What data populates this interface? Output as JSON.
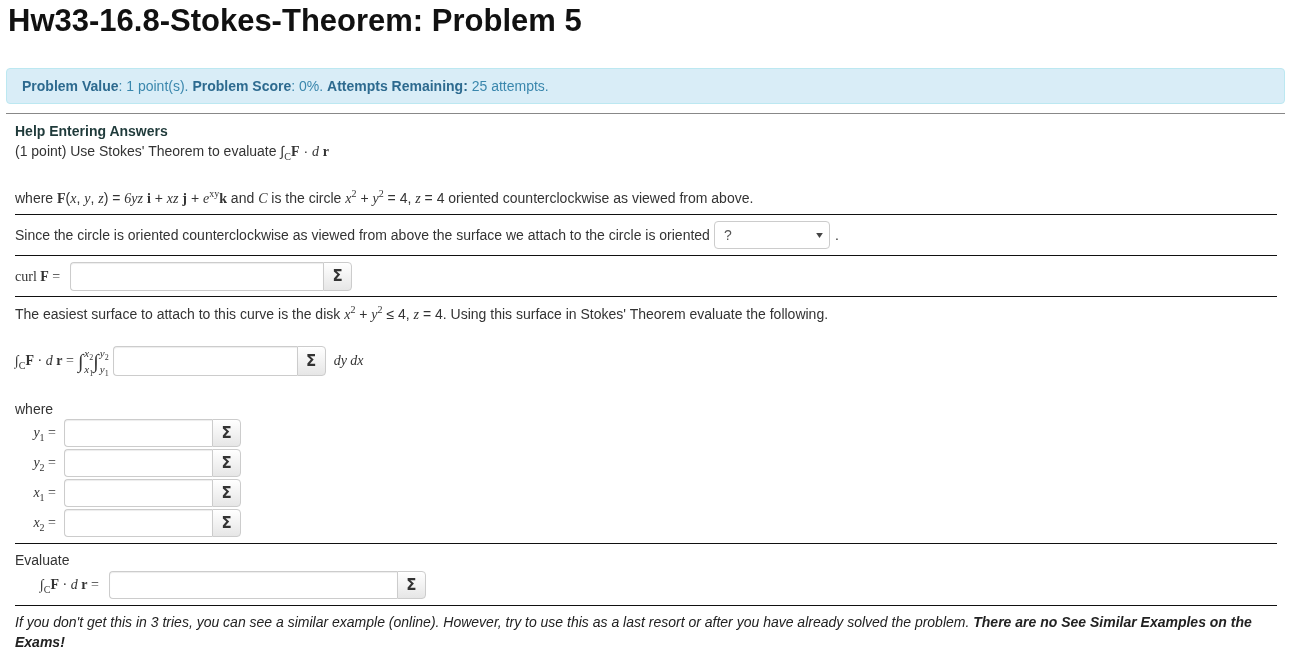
{
  "page_title": "Hw33-16.8-Stokes-Theorem: Problem 5",
  "info_bar": {
    "text": "**Problem Value**: 1 point(s). **Problem Score**: 0%. **Attempts Remaining:** 25 attempts."
  },
  "help_link": "Help Entering Answers",
  "problem": {
    "intro": "(1 point) Use Stokes' Theorem to evaluate ∫$_{C}$**F** · *d* **r**",
    "statement": "where **F**(*x*, *y*, *z*) = *6yz* **i** + *xz* **j** + *e*$^{xy}$**k** and *C* is the circle *x*$^{2}$ + *y*$^{2}$ = 4, *z* = 4 oriented counterclockwise as viewed from above.",
    "orientation": {
      "text": "Since the circle is oriented counterclockwise as viewed from above the surface we attach to the circle is oriented",
      "dropdown": {
        "value": "?"
      },
      "text_after": "."
    },
    "curl": {
      "label": "curl **F** =",
      "button": "Σ"
    },
    "surface_text": "The easiest surface to attach to this curve is the disk *x*$^{2}$ + *y*$^{2}$ ≤ 4, *z* = 4. Using this surface in Stokes' Theorem evaluate the following.",
    "double_integral": {
      "lhs": "∫$_{C}$**F** · *d* **r** =",
      "integrals": [
        {
          "sign": "∫",
          "upper": "*x*$_{2}$",
          "lower": "*x*$_{1}$"
        },
        {
          "sign": "∫",
          "upper": "*y*$_{2}$",
          "lower": "*y*$_{1}$"
        }
      ],
      "button": "Σ",
      "differentials": "dy dx"
    },
    "where_label": "where",
    "limits": [
      {
        "label": "*y*$_{1}$ =",
        "button": "Σ"
      },
      {
        "label": "*y*$_{2}$ =",
        "button": "Σ"
      },
      {
        "label": "*x*$_{1}$ =",
        "button": "Σ"
      },
      {
        "label": "*x*$_{2}$ =",
        "button": "Σ"
      }
    ],
    "evaluate_label": "Evaluate",
    "evaluate": {
      "label": "∫$_{C}$**F** · *d* **r** =",
      "button": "Σ"
    }
  },
  "footer_note": "If you don't get this in 3 tries, you can see a similar example (online). However, try to use this as a last resort or after you have already solved the problem. **There are no See Similar Examples on the Exams!**"
}
